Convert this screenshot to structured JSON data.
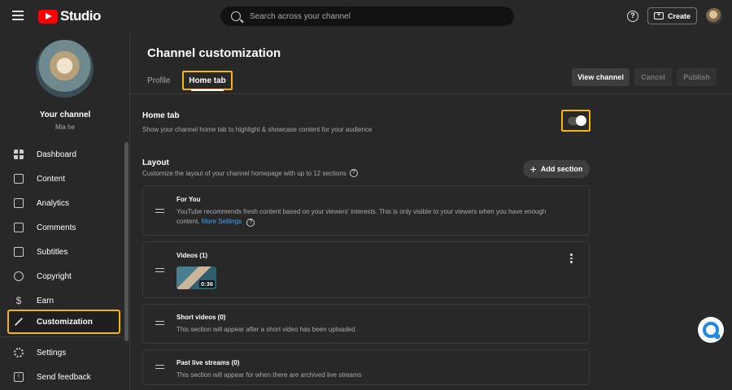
{
  "topbar": {
    "logo_text": "Studio",
    "search_placeholder": "Search across your channel",
    "help_label": "?",
    "create_label": "Create"
  },
  "sidebar": {
    "channel_label": "Your channel",
    "channel_handle": "Mia he",
    "items": [
      {
        "label": "Dashboard",
        "icon": "dashboard-icon"
      },
      {
        "label": "Content",
        "icon": "content-icon"
      },
      {
        "label": "Analytics",
        "icon": "analytics-icon"
      },
      {
        "label": "Comments",
        "icon": "comments-icon"
      },
      {
        "label": "Subtitles",
        "icon": "subtitles-icon"
      },
      {
        "label": "Copyright",
        "icon": "copyright-icon"
      },
      {
        "label": "Earn",
        "icon": "dollar-icon"
      },
      {
        "label": "Customization",
        "icon": "magic-wand-icon"
      },
      {
        "label": "Settings",
        "icon": "gear-icon"
      },
      {
        "label": "Send feedback",
        "icon": "feedback-icon"
      }
    ]
  },
  "header": {
    "title": "Channel customization",
    "tabs": [
      {
        "label": "Profile"
      },
      {
        "label": "Home tab"
      }
    ],
    "buttons": {
      "view_channel": "View channel",
      "cancel": "Cancel",
      "publish": "Publish"
    }
  },
  "home_tab": {
    "title": "Home tab",
    "description": "Show your channel home tab to highlight & showcase content for your audience",
    "enabled": true
  },
  "layout": {
    "title": "Layout",
    "description": "Customize the layout of your channel homepage with up to 12 sections",
    "add_section_label": "Add section",
    "sections": [
      {
        "title": "For You",
        "description": "YouTube recommends fresh content based on your viewers' interests. This is only visible to your viewers when you have enough content.",
        "link": "More Settings"
      },
      {
        "title": "Videos (1)",
        "thumbnail_duration": "0:36"
      },
      {
        "title": "Short videos (0)",
        "description": "This section will appear after a short video has been uploaded"
      },
      {
        "title": "Past live streams (0)",
        "description": "This section will appear for when there are archived live streams"
      }
    ]
  }
}
